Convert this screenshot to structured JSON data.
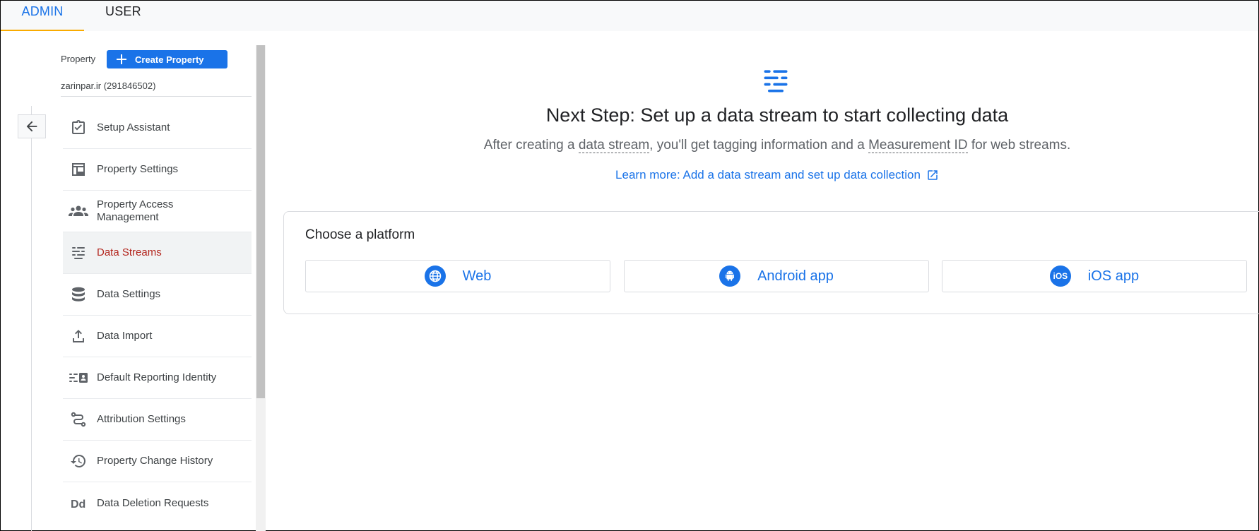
{
  "tabs": [
    {
      "label": "ADMIN",
      "active": true
    },
    {
      "label": "USER",
      "active": false
    }
  ],
  "sidebar": {
    "property_label": "Property",
    "create_button": "Create Property",
    "property_name": "zarinpar.ir (291846502)",
    "items": [
      {
        "label": "Setup Assistant",
        "icon": "clipboard-check-icon"
      },
      {
        "label": "Property Settings",
        "icon": "layout-icon"
      },
      {
        "label": "Property Access Management",
        "icon": "people-icon"
      },
      {
        "label": "Data Streams",
        "icon": "data-streams-icon",
        "active": true
      },
      {
        "label": "Data Settings",
        "icon": "database-icon"
      },
      {
        "label": "Data Import",
        "icon": "upload-icon"
      },
      {
        "label": "Default Reporting Identity",
        "icon": "reporting-identity-icon"
      },
      {
        "label": "Attribution Settings",
        "icon": "attribution-icon"
      },
      {
        "label": "Property Change History",
        "icon": "history-icon"
      },
      {
        "label": "Data Deletion Requests",
        "icon": "dd-icon"
      }
    ]
  },
  "main": {
    "headline": "Next Step: Set up a data stream to start collecting data",
    "sub_before": "After creating a ",
    "sub_link1": "data stream",
    "sub_middle": ", you'll get tagging information and a ",
    "sub_link2": "Measurement ID",
    "sub_after": " for web streams.",
    "learn_more": "Learn more: Add a data stream and set up data collection",
    "platform_title": "Choose a platform",
    "platforms": [
      {
        "label": "Web",
        "icon": "globe-icon"
      },
      {
        "label": "Android app",
        "icon": "android-icon"
      },
      {
        "label": "iOS app",
        "icon": "ios-icon",
        "badge": "iOS"
      }
    ]
  },
  "colors": {
    "accent": "#1a73e8",
    "active_text": "#b3261e",
    "tab_underline": "#f9ab00"
  }
}
